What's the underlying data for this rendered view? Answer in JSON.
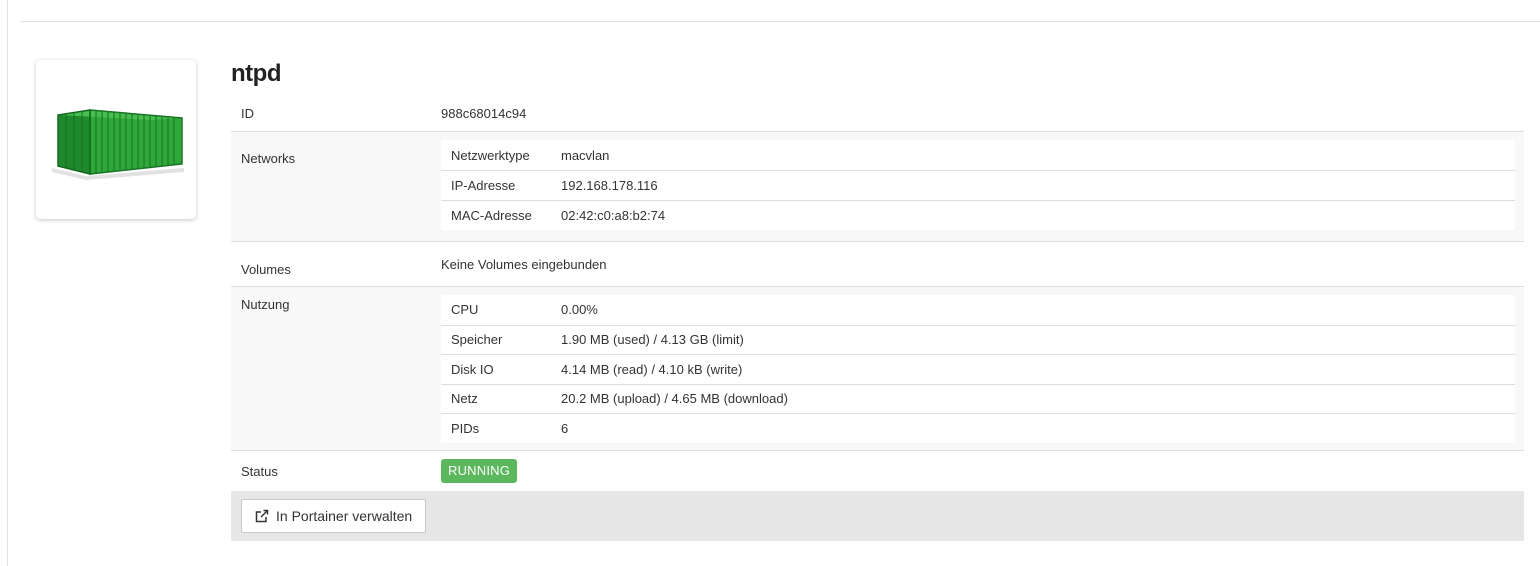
{
  "container": {
    "name": "ntpd",
    "image_icon": "shipping-container-icon"
  },
  "details": {
    "id_label": "ID",
    "id_value": "988c68014c94",
    "networks_label": "Networks",
    "networks": [
      {
        "key": "Netzwerktype",
        "value": "macvlan"
      },
      {
        "key": "IP-Adresse",
        "value": "192.168.178.116"
      },
      {
        "key": "MAC-Adresse",
        "value": "02:42:c0:a8:b2:74"
      }
    ],
    "volumes_label": "Volumes",
    "volumes_value": "Keine Volumes eingebunden",
    "usage_label": "Nutzung",
    "usage": [
      {
        "key": "CPU",
        "value": "0.00%"
      },
      {
        "key": "Speicher",
        "value": "1.90 MB (used) / 4.13 GB (limit)"
      },
      {
        "key": "Disk IO",
        "value": "4.14 MB (read) / 4.10 kB (write)"
      },
      {
        "key": "Netz",
        "value": "20.2 MB (upload) / 4.65 MB (download)"
      },
      {
        "key": "PIDs",
        "value": "6"
      }
    ],
    "status_label": "Status",
    "status_value": "RUNNING"
  },
  "actions": {
    "portainer_label": "In Portainer verwalten",
    "portainer_icon": "external-link-icon"
  },
  "colors": {
    "status_running": "#5cb85c",
    "container_green": "#2fa83a"
  }
}
